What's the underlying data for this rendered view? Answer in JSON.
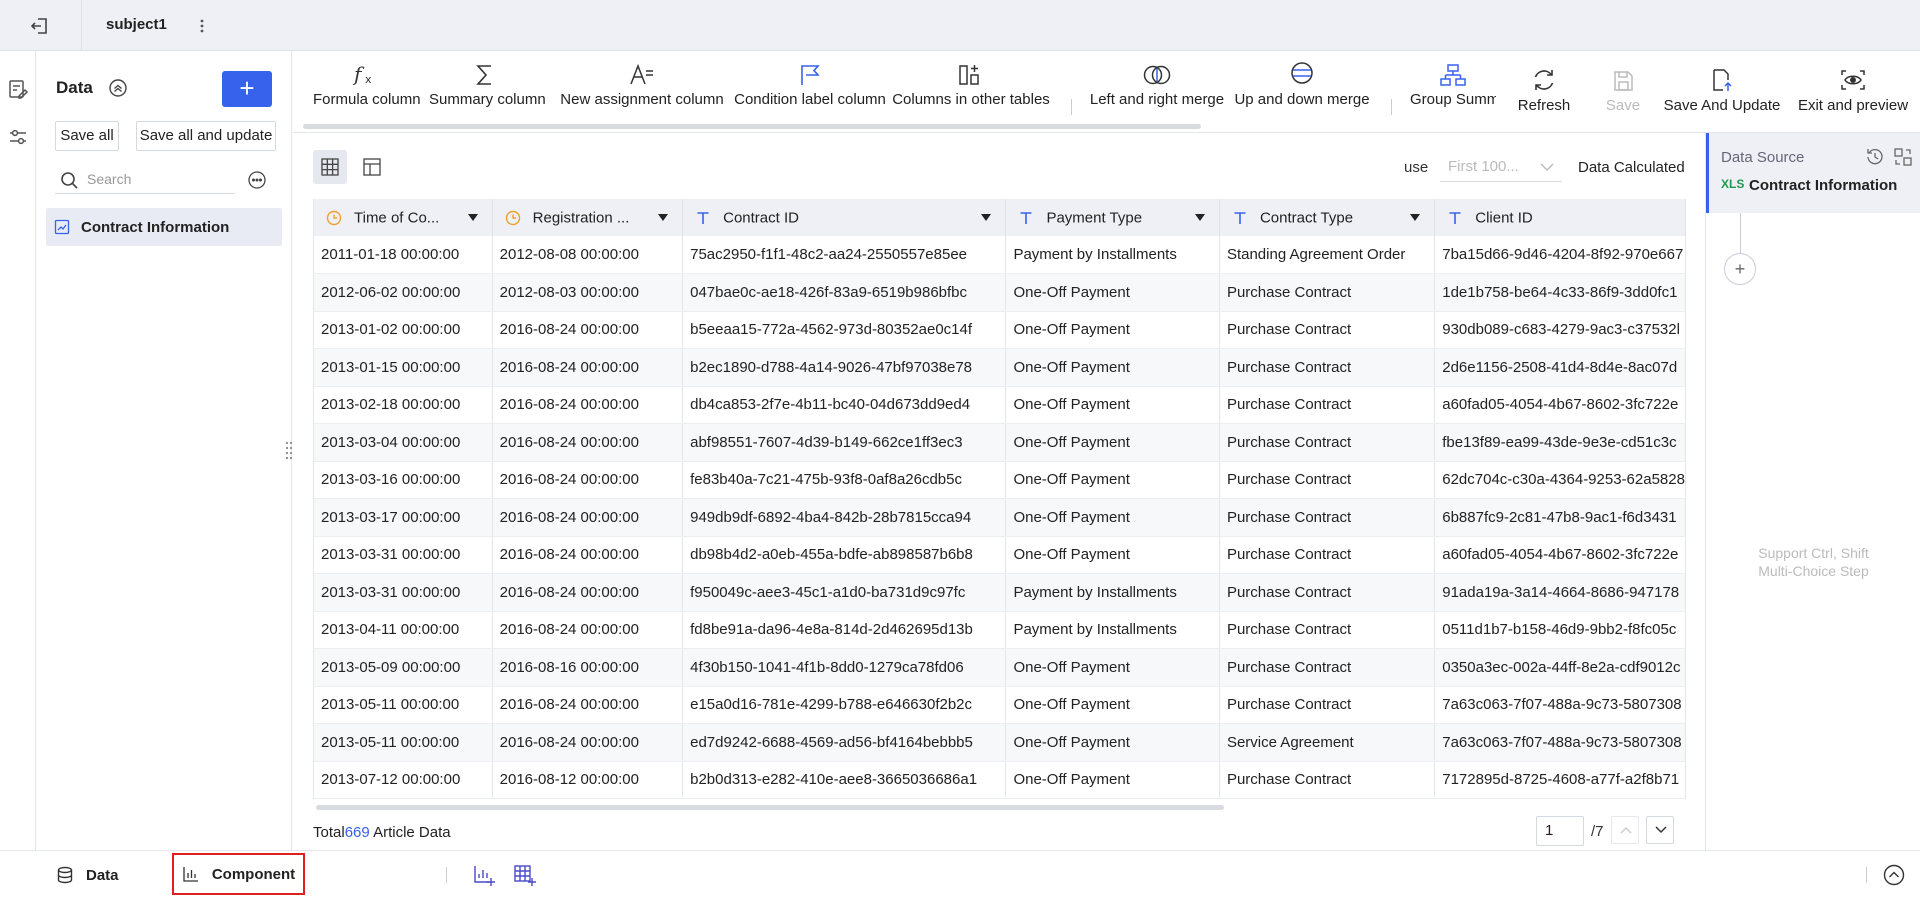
{
  "topbar": {
    "title": "subject1"
  },
  "data_panel": {
    "title": "Data",
    "add_label": "+",
    "save_all": "Save all",
    "save_all_update": "Save all and update",
    "search_placeholder": "Search",
    "tables": [
      {
        "name": "Contract Information"
      }
    ]
  },
  "toolbar": {
    "formula": "Formula column",
    "summary": "Summary column",
    "assignment": "New assignment column",
    "condition": "Condition label column",
    "other_tables": "Columns in other tables",
    "lr_merge": "Left and right merge",
    "ud_merge": "Up and down merge",
    "group": "Group Summ",
    "refresh": "Refresh",
    "save": "Save",
    "save_update": "Save And Update",
    "exit_preview": "Exit and preview"
  },
  "view": {
    "use_label": "use",
    "use_value": "First 100...",
    "calculated": "Data Calculated"
  },
  "grid": {
    "columns": [
      {
        "label": "Time of Co...",
        "type": "date"
      },
      {
        "label": "Registration ...",
        "type": "date"
      },
      {
        "label": "Contract ID",
        "type": "text"
      },
      {
        "label": "Payment Type",
        "type": "text"
      },
      {
        "label": "Contract Type",
        "type": "text"
      },
      {
        "label": "Client ID",
        "type": "text"
      }
    ],
    "rows": [
      [
        "2011-01-18 00:00:00",
        "2012-08-08 00:00:00",
        "75ac2950-f1f1-48c2-aa24-2550557e85ee",
        "Payment by Installments",
        "Standing Agreement Order",
        "7ba15d66-9d46-4204-8f92-970e667"
      ],
      [
        "2012-06-02 00:00:00",
        "2012-08-03 00:00:00",
        "047bae0c-ae18-426f-83a9-6519b986bfbc",
        "One-Off Payment",
        "Purchase Contract",
        "1de1b758-be64-4c33-86f9-3dd0fc1"
      ],
      [
        "2013-01-02 00:00:00",
        "2016-08-24 00:00:00",
        "b5eeaa15-772a-4562-973d-80352ae0c14f",
        "One-Off Payment",
        "Purchase Contract",
        "930db089-c683-4279-9ac3-c37532l"
      ],
      [
        "2013-01-15 00:00:00",
        "2016-08-24 00:00:00",
        "b2ec1890-d788-4a14-9026-47bf97038e78",
        "One-Off Payment",
        "Purchase Contract",
        "2d6e1156-2508-41d4-8d4e-8ac07d"
      ],
      [
        "2013-02-18 00:00:00",
        "2016-08-24 00:00:00",
        "db4ca853-2f7e-4b11-bc40-04d673dd9ed4",
        "One-Off Payment",
        "Purchase Contract",
        "a60fad05-4054-4b67-8602-3fc722e"
      ],
      [
        "2013-03-04 00:00:00",
        "2016-08-24 00:00:00",
        "abf98551-7607-4d39-b149-662ce1ff3ec3",
        "One-Off Payment",
        "Purchase Contract",
        "fbe13f89-ea99-43de-9e3e-cd51c3c"
      ],
      [
        "2013-03-16 00:00:00",
        "2016-08-24 00:00:00",
        "fe83b40a-7c21-475b-93f8-0af8a26cdb5c",
        "One-Off Payment",
        "Purchase Contract",
        "62dc704c-c30a-4364-9253-62a5828"
      ],
      [
        "2013-03-17 00:00:00",
        "2016-08-24 00:00:00",
        "949db9df-6892-4ba4-842b-28b7815cca94",
        "One-Off Payment",
        "Purchase Contract",
        "6b887fc9-2c81-47b8-9ac1-f6d3431"
      ],
      [
        "2013-03-31 00:00:00",
        "2016-08-24 00:00:00",
        "db98b4d2-a0eb-455a-bdfe-ab898587b6b8",
        "One-Off Payment",
        "Purchase Contract",
        "a60fad05-4054-4b67-8602-3fc722e"
      ],
      [
        "2013-03-31 00:00:00",
        "2016-08-24 00:00:00",
        "f950049c-aee3-45c1-a1d0-ba731d9c97fc",
        "Payment by Installments",
        "Purchase Contract",
        "91ada19a-3a14-4664-8686-947178"
      ],
      [
        "2013-04-11 00:00:00",
        "2016-08-24 00:00:00",
        "fd8be91a-da96-4e8a-814d-2d462695d13b",
        "Payment by Installments",
        "Purchase Contract",
        "0511d1b7-b158-46d9-9bb2-f8fc05c"
      ],
      [
        "2013-05-09 00:00:00",
        "2016-08-16 00:00:00",
        "4f30b150-1041-4f1b-8dd0-1279ca78fd06",
        "One-Off Payment",
        "Purchase Contract",
        "0350a3ec-002a-44ff-8e2a-cdf9012c"
      ],
      [
        "2013-05-11 00:00:00",
        "2016-08-24 00:00:00",
        "e15a0d16-781e-4299-b788-e646630f2b2c",
        "One-Off Payment",
        "Purchase Contract",
        "7a63c063-7f07-488a-9c73-5807308"
      ],
      [
        "2013-05-11 00:00:00",
        "2016-08-24 00:00:00",
        "ed7d9242-6688-4569-ad56-bf4164bebbb5",
        "One-Off Payment",
        "Service Agreement",
        "7a63c063-7f07-488a-9c73-5807308"
      ],
      [
        "2013-07-12 00:00:00",
        "2016-08-12 00:00:00",
        "b2b0d313-e282-410e-aee8-3665036686a1",
        "One-Off Payment",
        "Purchase Contract",
        "7172895d-8725-4608-a77f-a2f8b71"
      ]
    ]
  },
  "footer": {
    "total_prefix": "Total",
    "total_count": "669",
    "total_suffix": "Article Data",
    "page": "1",
    "pages": "/7"
  },
  "data_source": {
    "title": "Data Source",
    "file_badge": "XLS",
    "name": "Contract Information",
    "add": "+",
    "hint_line1": "Support Ctrl, Shift",
    "hint_line2": "Multi-Choice Step"
  },
  "bottom": {
    "data_tab": "Data",
    "component_tab": "Component"
  },
  "colors": {
    "accent": "#3662ec",
    "highlight_border": "#e02020",
    "date_icon": "#f0a030",
    "text_icon": "#3662ec"
  }
}
